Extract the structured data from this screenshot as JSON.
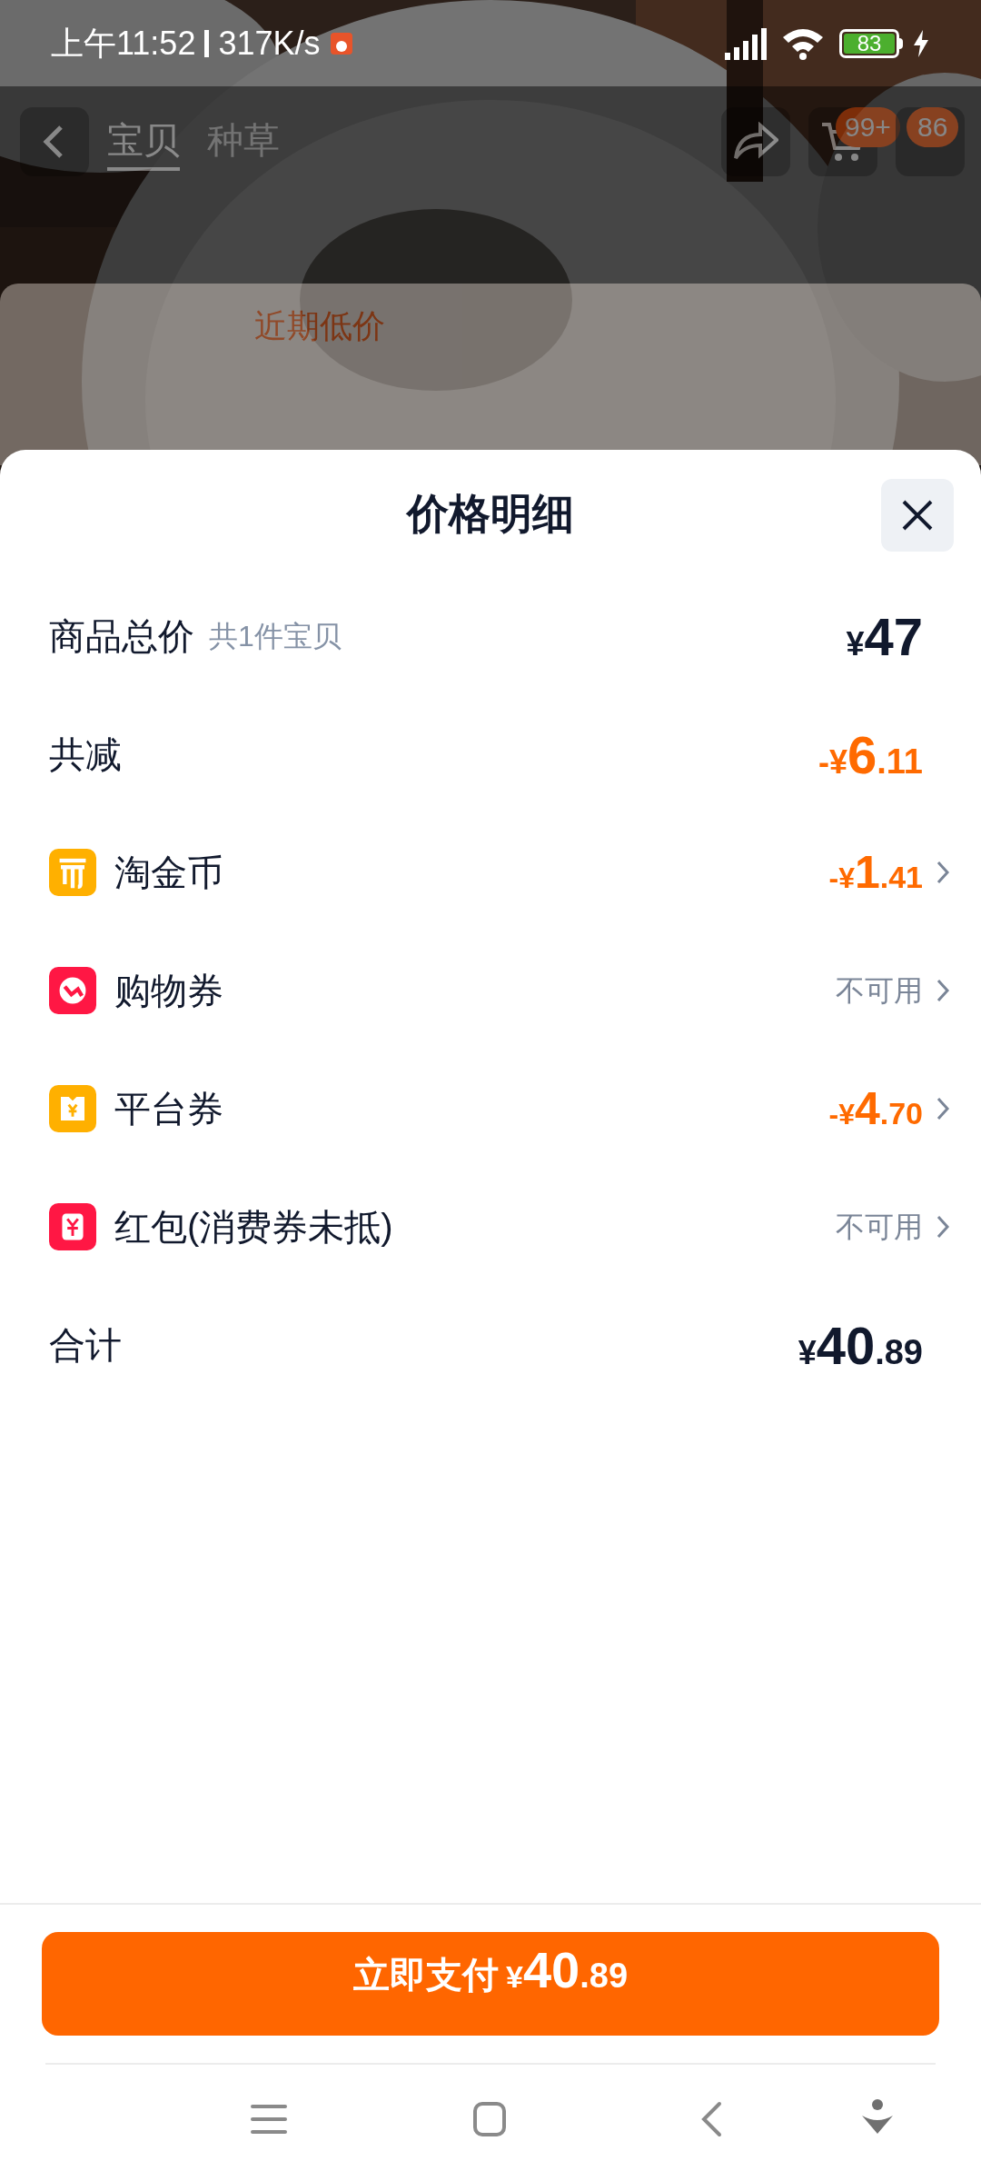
{
  "status_bar": {
    "time": "上午11:52",
    "speed": "317K/s",
    "battery": "83"
  },
  "background_page": {
    "tabs": [
      {
        "label": "宝贝",
        "selected": true
      },
      {
        "label": "种草",
        "selected": false
      }
    ],
    "cart_badge": "99+",
    "message_badge": "86",
    "price_tag": "近期低价"
  },
  "sheet": {
    "title": "价格明细",
    "rows": [
      {
        "kind": "summary",
        "label": "商品总价",
        "note": "共1件宝贝",
        "amount": {
          "prefix": "¥",
          "integer": "47"
        },
        "negative": false
      },
      {
        "kind": "summary",
        "label": "共减",
        "amount": {
          "prefix": "-¥",
          "integer": "6",
          "decimal": ".11"
        },
        "negative": true
      },
      {
        "kind": "coin",
        "color": "#ffb000",
        "label": "淘金币",
        "amount": {
          "prefix": "-¥",
          "integer": "1",
          "decimal": ".41"
        },
        "negative": true
      },
      {
        "kind": "coupon",
        "color": "#ff1744",
        "label": "购物券",
        "status_text": "不可用"
      },
      {
        "kind": "platform-coupon",
        "color": "#ffb000",
        "label": "平台券",
        "amount": {
          "prefix": "-¥",
          "integer": "4",
          "decimal": ".70"
        },
        "negative": true
      },
      {
        "kind": "red-packet",
        "color": "#ff1744",
        "label": "红包(消费券未抵)",
        "status_text": "不可用"
      },
      {
        "kind": "summary",
        "label": "合计",
        "amount": {
          "prefix": "¥",
          "integer": "40",
          "decimal": ".89"
        },
        "negative": false
      }
    ],
    "pay_button": {
      "label": "立即支付",
      "amount": {
        "prefix": "¥",
        "integer": "40",
        "decimal": ".89"
      }
    }
  }
}
